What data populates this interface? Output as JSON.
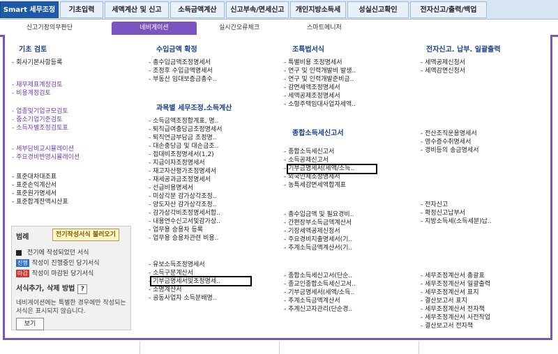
{
  "top_tabs": [
    "Smart 세무조정",
    "기초입력",
    "세액계산 및 신고",
    "소득금액계산",
    "신고부속/면세신고",
    "개인지방소득세",
    "성실신고확인",
    "전자신고/출력/백업"
  ],
  "sub_tabs": [
    "신고기장의무판단",
    "네비게이션",
    "실시간오류체크",
    "스마트메니저"
  ],
  "col1": {
    "header": "기초 검토",
    "items": [
      {
        "label": "회사기본사항등록",
        "type": "normal"
      },
      {
        "label": "재무제표계정검토",
        "type": "link"
      },
      {
        "label": "비용계정검토",
        "type": "link"
      },
      {
        "label": "업종및기업규모검토",
        "type": "link"
      },
      {
        "label": "중소기업기준검토",
        "type": "link"
      },
      {
        "label": "소득자별조정검토표",
        "type": "link"
      },
      {
        "label": "세부담비교시뮬레이션",
        "type": "link"
      },
      {
        "label": "주요경비반영시뮬레이션",
        "type": "link"
      },
      {
        "label": "표준대차대조표",
        "type": "normal"
      },
      {
        "label": "표준손익계산서",
        "type": "normal"
      },
      {
        "label": "표준원가명세서",
        "type": "normal"
      },
      {
        "label": "표준합계잔액시산표",
        "type": "normal"
      }
    ]
  },
  "legend": {
    "title": "범례",
    "button": "전기작성서식 불러오기",
    "rows": [
      {
        "badge": "■",
        "text": "전기에 작성되었던 서식"
      },
      {
        "badge": "진행",
        "text": "작성이 진행중인 당기서식"
      },
      {
        "badge": "마감",
        "text": "작성이 마감된 당기서식"
      }
    ],
    "howto": "서식추가, 삭제 방법",
    "q": "?",
    "note": "네비게이션에는 특별한 경우에만 작성되는 서식은 표시되지 않습니다.",
    "view": "보기"
  },
  "col2": {
    "header1": "수입금액 확정",
    "items1": [
      "총수입금액조정명세서",
      "조정후 수입금액명세서",
      "부동산 임대보증금총수.."
    ],
    "header2": "과목별 세무조정.소득계산",
    "items2": [
      "소득금액조정합계표, 명..",
      "퇴직급여충당금조정명세서",
      "퇴직연금부담금 조정명..",
      "대손충당금 및 대손금조..",
      "접대비조정명세서(1,2)",
      "지급이자조정명세서",
      "재고자산평가조정명세서",
      "재세공과금조정명세서",
      "선급비용명세서",
      "미상각분 감가상각조정..",
      "양도자산 감가상각조정..",
      "감가상각비조정명세서합..",
      "내용연수신고서및감가상..",
      "업무용 승용차 등록",
      "업무용 승용차관련 비용.."
    ],
    "items3": [
      "유보소득조정명세서",
      "소득구분계산서",
      "기부금명세서및조정명세..",
      "소명계산서",
      "공동사업자 소득분배명.."
    ]
  },
  "col3": {
    "header1": "조특법서식",
    "items1": [
      "특별비용 조정명세서",
      "연구 및 인력개발비 발생..",
      "연구 및 인력개발준비금..",
      "감면세액조정명세서",
      "세액공제조정명세서",
      "소형주택임대사업자세액.."
    ],
    "header2": "종합소득세신고서",
    "items2": [
      "종합소득세신고서",
      "소득공제신고서",
      "기부금명세서(세액/소득..",
      "외국인세조정명세서",
      "농특세감면세액합계표"
    ],
    "items3": [
      "총수입금액 및 필요경비..",
      "간편장부소득금액계산서",
      "기장세액공제신청서",
      "주요경비지출명세서(기..",
      "추계소득금액계산서(기.."
    ],
    "items4": [
      "종합소득세신고서(단순..",
      "종교인종합소득세신고서..",
      "기부금명세서(세액/소득..",
      "추계소득금액계산서",
      "추계신고자관리(단순경.."
    ]
  },
  "col4": {
    "header1": "전자신고. 납부. 일괄출력",
    "items1": [
      "세액공제신청서",
      "세액감면신청서"
    ],
    "items2": [
      "전산조직운용명세서",
      "영수증수취명세서",
      "경비등의 송금명세서"
    ],
    "items3": [
      "전자신고",
      "확정신고납부서",
      "지방소득세(소득세분)납.."
    ],
    "items4": [
      "세무조정계산서 총괄표",
      "세무조정계산서 일괄출력",
      "세무조정계산서 표지",
      "결산보고서 표지",
      "세무조정계산서 전자책",
      "세무조정계산서 사전작업",
      "결산보고서 전자책"
    ]
  },
  "colors": {
    "purple": "#7a55c0",
    "blue": "#1f5aa8",
    "header_text": "#1d3f8f"
  }
}
